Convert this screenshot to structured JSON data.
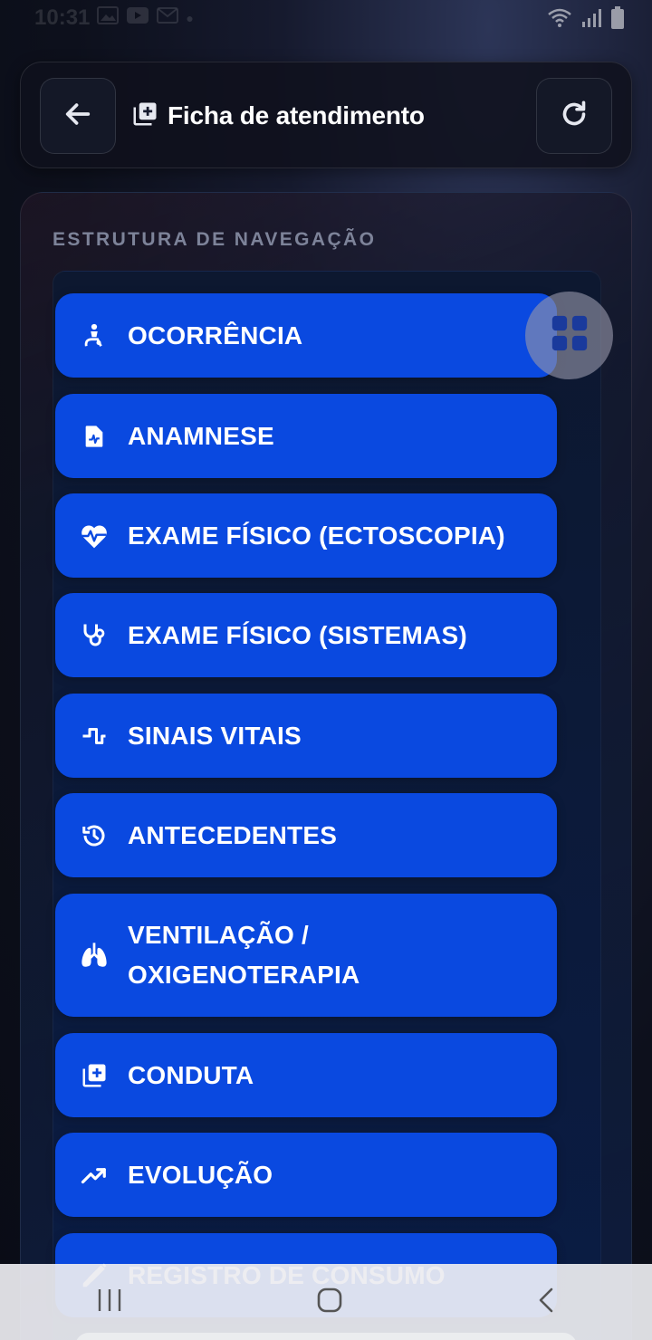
{
  "status_bar": {
    "time": "10:31",
    "icons": [
      "gallery-icon",
      "youtube-icon",
      "gmail-icon",
      "dot-icon",
      "wifi-icon",
      "signal-icon",
      "battery-icon"
    ]
  },
  "header": {
    "back_icon": "arrow-left-icon",
    "title_icon": "library-add-icon",
    "title": "Ficha de atendimento",
    "refresh_icon": "refresh-icon"
  },
  "navigation": {
    "section_label": "ESTRUTURA DE NAVEGAÇÃO",
    "items": [
      {
        "label": "OCORRÊNCIA",
        "icon": "accident-person-icon"
      },
      {
        "label": "ANAMNESE",
        "icon": "medical-file-icon"
      },
      {
        "label": "EXAME FÍSICO (ECTOSCOPIA)",
        "icon": "heart-pulse-icon"
      },
      {
        "label": "EXAME FÍSICO (SISTEMAS)",
        "icon": "stethoscope-icon"
      },
      {
        "label": "SINAIS VITAIS",
        "icon": "pulse-wave-icon"
      },
      {
        "label": "ANTECEDENTES",
        "icon": "history-icon"
      },
      {
        "label_line1": "VENTILAÇÃO /",
        "label_line2": "OXIGENOTERAPIA",
        "icon": "lungs-icon"
      },
      {
        "label": "CONDUTA",
        "icon": "library-add-icon"
      },
      {
        "label": "EVOLUÇÃO",
        "icon": "trending-up-icon"
      },
      {
        "label": "REGISTRO DE CONSUMO",
        "icon": "syringe-icon"
      }
    ],
    "fab_icon": "grid-icon"
  },
  "system_nav": {
    "icons": [
      "recent-apps-icon",
      "home-icon",
      "back-icon"
    ]
  },
  "colors": {
    "accent": "#0a49e0",
    "background": "#0d101c",
    "section_label": "#7d8399"
  }
}
